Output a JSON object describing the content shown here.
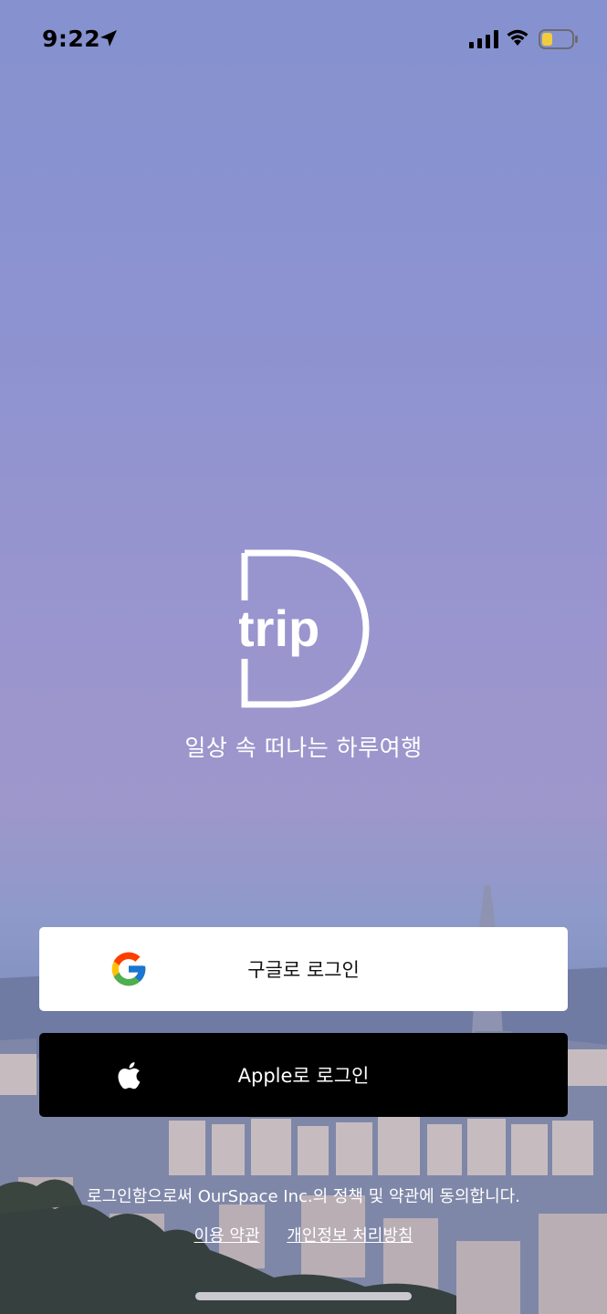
{
  "status_bar": {
    "time": "9:22",
    "icons": [
      "location-arrow-icon",
      "cellular-signal-icon",
      "wifi-icon",
      "battery-low-icon"
    ],
    "battery_color": "#f2cc3c"
  },
  "brand": {
    "logo_text": "trip",
    "logo_letter": "D",
    "tagline": "일상 속 떠나는 하루여행"
  },
  "login": {
    "google_label": "구글로 로그인",
    "apple_label": "Apple로 로그인"
  },
  "footer": {
    "legal_text": "로그인함으로써 OurSpace Inc.의 정책 및 약관에 동의합니다.",
    "terms_link": "이용 약관",
    "privacy_link": "개인정보 처리방침"
  },
  "colors": {
    "sky_top": "#8592cf",
    "google_button_bg": "#ffffff",
    "apple_button_bg": "#000000"
  }
}
